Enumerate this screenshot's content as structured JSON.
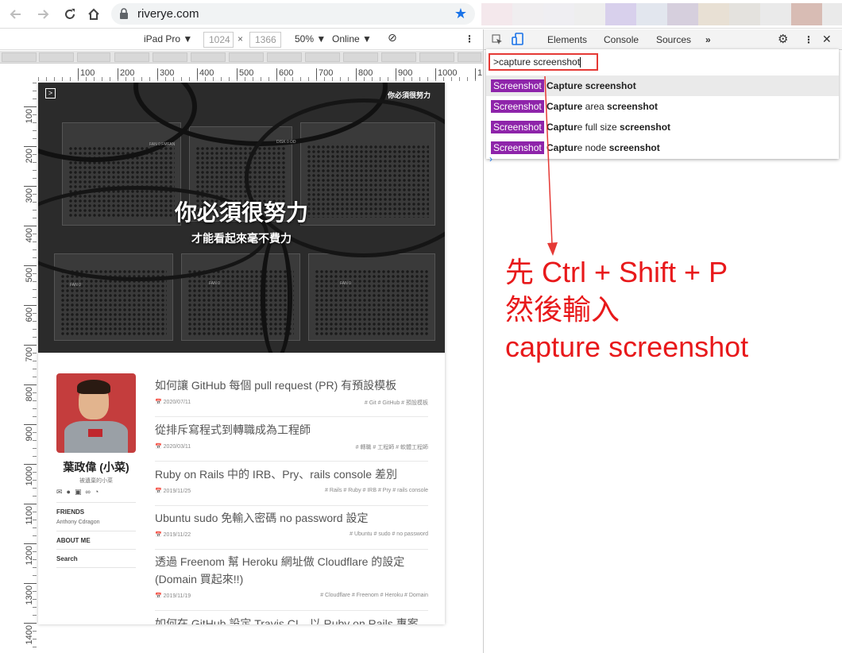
{
  "browser": {
    "url": "riverye.com",
    "extension_colors": [
      "#f4e8ec",
      "#f0eef0",
      "#efeef2",
      "#eeeeee",
      "#d8d0ec",
      "#e2e6ee",
      "#d6cfdd",
      "#e8e0d4",
      "#e4e2de",
      "#eaeaea",
      "#d8bcb4",
      "#eaeaea"
    ]
  },
  "device_toolbar": {
    "device": "iPad Pro",
    "width": "1024",
    "height": "1366",
    "zoom": "50%",
    "throttle": "Online",
    "ruler_h": [
      "100",
      "200",
      "300",
      "400",
      "500",
      "600",
      "700",
      "800",
      "900",
      "1000",
      "1"
    ],
    "ruler_v": [
      "100",
      "200",
      "300",
      "400",
      "500",
      "600",
      "700",
      "800",
      "900",
      "1000",
      "1100",
      "1200",
      "1300",
      "1400"
    ]
  },
  "site": {
    "brand": "你必須很努力",
    "hero_title": "你必須很努力",
    "hero_subtitle": "才能看起來毫不費力",
    "hero_labels": [
      "FAN 0 FMFAN",
      "DISK 0 DD",
      "FAN 0",
      "FAN 0",
      "FAN 0"
    ],
    "author_name": "葉政偉 (小菜)",
    "author_tagline": "被遺棄的小菜",
    "friends_heading": "FRIENDS",
    "friends": "Anthony   Cdragon",
    "about_heading": "ABOUT ME",
    "search_label": "Search",
    "posts": [
      {
        "title": "如何讓 GitHub 每個 pull request (PR) 有預設模板",
        "date": "📅 2020/07/11",
        "tags": "# Git  # GitHub  # 預設模板"
      },
      {
        "title": "從排斥寫程式到轉職成為工程師",
        "date": "📅 2020/03/11",
        "tags": "# 轉職  # 工程師  # 軟體工程師"
      },
      {
        "title": "Ruby on Rails 中的 IRB、Pry、rails console 差別",
        "date": "📅 2019/11/25",
        "tags": "# Rails  # Ruby  # IRB  # Pry  # rails console"
      },
      {
        "title": "Ubuntu sudo 免輸入密碼 no password 設定",
        "date": "📅 2019/11/22",
        "tags": "# Ubuntu  # sudo  # no password"
      },
      {
        "title": "透過 Freenom 幫 Heroku 網址做 Cloudflare 的設定 (Domain 買起來!!)",
        "date": "📅 2019/11/19",
        "tags": "# Cloudflare  # Freenom  # Heroku  # Domain"
      },
      {
        "title": "如何在 GitHub 設定 Travis CI，以 Ruby on Rails 專案為",
        "date": "",
        "tags": ""
      }
    ]
  },
  "devtools": {
    "tabs": [
      "Elements",
      "Console",
      "Sources"
    ],
    "command_input": ">capture screenshot",
    "commands": [
      {
        "badge": "Screenshot",
        "parts": [
          [
            "Capture",
            true
          ],
          [
            " ",
            false
          ],
          [
            "screenshot",
            true
          ]
        ]
      },
      {
        "badge": "Screenshot",
        "parts": [
          [
            "Capture",
            true
          ],
          [
            " area ",
            false
          ],
          [
            "screenshot",
            true
          ]
        ]
      },
      {
        "badge": "Screenshot",
        "parts": [
          [
            "Captur",
            true
          ],
          [
            "e full size ",
            false
          ],
          [
            "screenshot",
            true
          ]
        ]
      },
      {
        "badge": "Screenshot",
        "parts": [
          [
            "Captur",
            true
          ],
          [
            "e node ",
            false
          ],
          [
            "screenshot",
            true
          ]
        ]
      }
    ]
  },
  "annotation": {
    "color": "#e8191b",
    "lines": [
      "先 Ctrl + Shift + P",
      "然後輸入",
      "capture screenshot"
    ]
  }
}
